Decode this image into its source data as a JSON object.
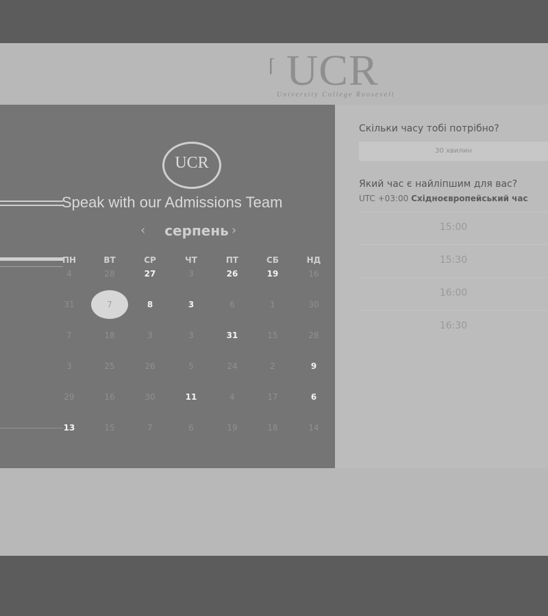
{
  "brand": {
    "logo_text": "UCR",
    "logo_subtitle": "University College Roosevelt"
  },
  "left": {
    "badge_text": "UCR",
    "title": "Speak with our Admissions Team",
    "month_label": "серпень",
    "prev_icon": "chevron-left-icon",
    "next_icon": "chevron-right-icon",
    "weekdays": [
      "ПН",
      "ВТ",
      "СР",
      "ЧТ",
      "ПТ",
      "СБ",
      "НД"
    ],
    "weeks": [
      [
        "4",
        "28",
        "27",
        "3",
        "26",
        "19",
        "16"
      ],
      [
        "31",
        "7",
        "8",
        "3",
        "6",
        "1",
        "30"
      ],
      [
        "7",
        "18",
        "3",
        "3",
        "31",
        "15",
        "28"
      ],
      [
        "3",
        "25",
        "26",
        "5",
        "24",
        "2",
        "9"
      ],
      [
        "29",
        "16",
        "30",
        "11",
        "4",
        "17",
        "6"
      ],
      [
        "13",
        "15",
        "7",
        "6",
        "19",
        "18",
        "14"
      ]
    ],
    "selected": "7"
  },
  "right": {
    "question_duration": "Скільки часу тобі потрібно?",
    "duration_value": "30 хвилин",
    "question_time": "Який час є найліпшим для вас?",
    "timezone_offset": "UTC +03:00",
    "timezone_name": "Східноєвропейський час",
    "slots": [
      "15:00",
      "15:30",
      "16:00",
      "16:30"
    ]
  }
}
